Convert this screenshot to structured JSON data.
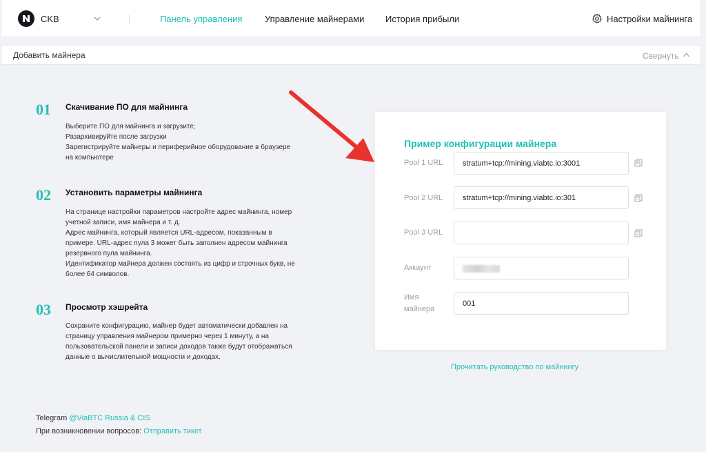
{
  "header": {
    "coin": "CKB",
    "nav": [
      "Панель управления",
      "Управление майнерами",
      "История прибыли"
    ],
    "settings_label": "Настройки майнинга"
  },
  "add_bar": {
    "title": "Добавить майнера",
    "collapse_label": "Свернуть"
  },
  "steps": [
    {
      "num": "01",
      "title": "Скачивание ПО для майнинга",
      "lines": [
        "Выберите ПО для майнинга и загрузите;",
        "Разархивируйте после загрузки",
        "Зарегистрируйте майнеры и периферийное оборудование в браузере",
        "на компьютере"
      ]
    },
    {
      "num": "02",
      "title": "Установить параметры майнинга",
      "lines": [
        "На странице настройки параметров настройте адрес майнинга, номер",
        "учетной записи, имя майнера и т. д.",
        "Адрес майнинга, который является URL-адресом, показанным в",
        "примере. URL-адрес пула 3 может быть заполнен адресом майнинга",
        "резервного пула майнинга.",
        "Идентификатор майнера должен состоять из цифр и строчных букв, не",
        "более 64 символов."
      ]
    },
    {
      "num": "03",
      "title": "Просмотр хэшрейта",
      "lines": [
        "Сохраните конфигурацию, майнер будет автоматически добавлен на",
        "страницу управления майнером примерно через 1 минуту, а на",
        "пользовательской панели и записи доходов также будут отображаться",
        "данные о вычислительной мощности и доходах."
      ]
    }
  ],
  "config": {
    "title": "Пример конфигурации майнера",
    "pool1_label": "Pool 1 URL",
    "pool1_value": "stratum+tcp://mining.viabtc.io:3001",
    "pool2_label": "Pool 2 URL",
    "pool2_value": "stratum+tcp://mining.viabtc.io:301",
    "pool3_label": "Pool 3 URL",
    "pool3_value": "",
    "account_label": "Аккаунт",
    "miner_label_1": "Имя",
    "miner_label_2": "майнера",
    "miner_value": "001"
  },
  "guide_link": "Прочитать руководство по майнингу",
  "footer": {
    "telegram_label": "Telegram",
    "telegram_link": "@ViaBTC Russia & CIS",
    "questions_label": "При возникновении вопросов:",
    "ticket_link": "Отправить тикет"
  },
  "colors": {
    "accent": "#20bfb5",
    "arrow": "#e8322b"
  }
}
